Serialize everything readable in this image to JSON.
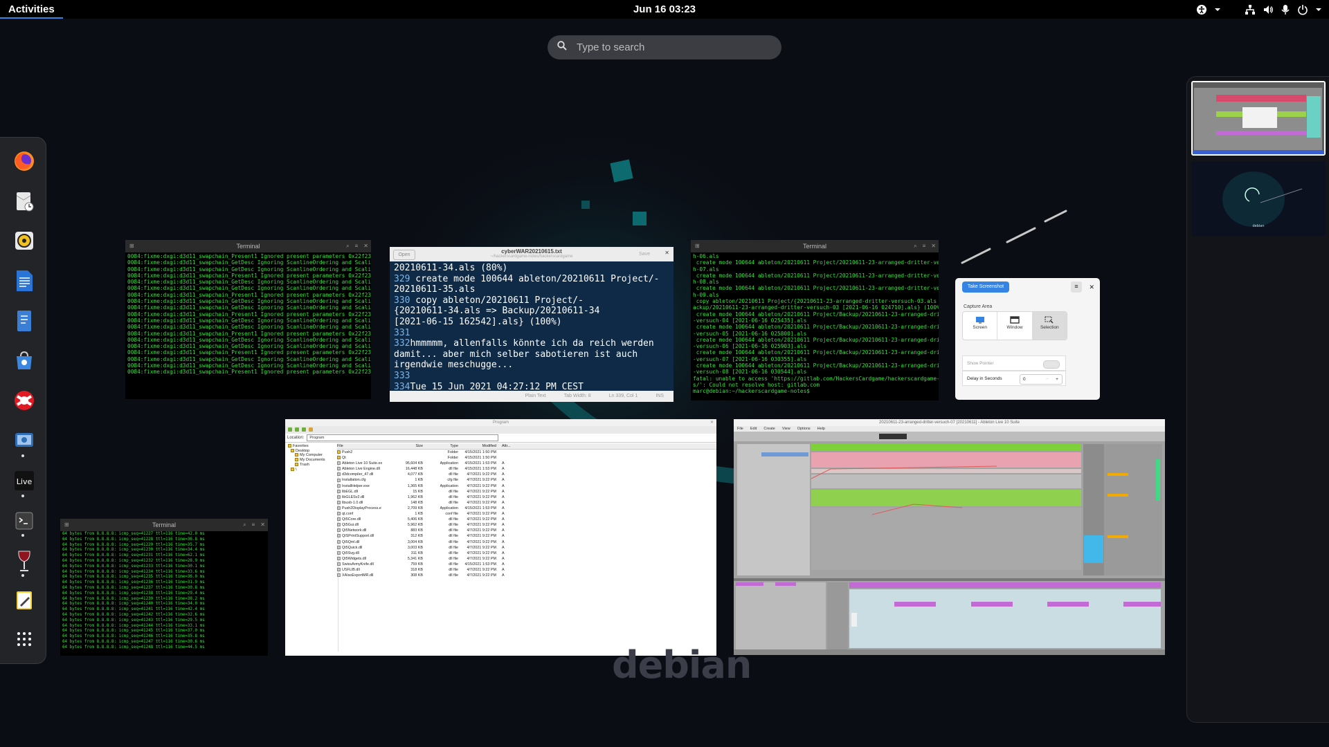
{
  "topbar": {
    "activities_label": "Activities",
    "clock": "Jun 16  03:23",
    "tray_icons": [
      "accessibility-icon",
      "chevron-down-icon",
      "network-icon",
      "volume-icon",
      "microphone-icon",
      "power-icon",
      "chevron-down-icon"
    ]
  },
  "search": {
    "placeholder": "Type to search",
    "value": ""
  },
  "dash": {
    "apps": [
      {
        "name": "firefox-icon",
        "running": false
      },
      {
        "name": "evolution-icon",
        "running": false
      },
      {
        "name": "rhythmbox-icon",
        "running": false
      },
      {
        "name": "writer-icon",
        "running": false
      },
      {
        "name": "document-viewer-icon",
        "running": false
      },
      {
        "name": "software-icon",
        "running": false
      },
      {
        "name": "help-icon",
        "running": false
      },
      {
        "name": "screenshot-icon",
        "running": true
      },
      {
        "name": "ableton-live-icon",
        "running": true
      },
      {
        "name": "terminal-icon",
        "running": true
      },
      {
        "name": "wine-icon",
        "running": true
      },
      {
        "name": "text-editor-icon",
        "running": false
      },
      {
        "name": "show-apps-icon",
        "running": false
      }
    ],
    "live_label": "Live"
  },
  "terminal1": {
    "title": "Terminal",
    "lines": [
      "0084:fixme:dxgi:d3d11_swapchain_Present1 Ignored present parameters 0x22f230.",
      "0084:fixme:dxgi:d3d11_swapchain_GetDesc Ignoring ScanlineOrdering and Scaling.",
      "0084:fixme:dxgi:d3d11_swapchain_GetDesc Ignoring ScanlineOrdering and Scaling.",
      "0084:fixme:dxgi:d3d11_swapchain_Present1 Ignored present parameters 0x22f230.",
      "0084:fixme:dxgi:d3d11_swapchain_GetDesc Ignoring ScanlineOrdering and Scaling.",
      "0084:fixme:dxgi:d3d11_swapchain_GetDesc Ignoring ScanlineOrdering and Scaling.",
      "0084:fixme:dxgi:d3d11_swapchain_Present1 Ignored present parameters 0x22f230.",
      "0084:fixme:dxgi:d3d11_swapchain_GetDesc Ignoring ScanlineOrdering and Scaling.",
      "0084:fixme:dxgi:d3d11_swapchain_GetDesc Ignoring ScanlineOrdering and Scaling.",
      "0084:fixme:dxgi:d3d11_swapchain_Present1 Ignored present parameters 0x22f230.",
      "0084:fixme:dxgi:d3d11_swapchain_GetDesc Ignoring ScanlineOrdering and Scaling.",
      "0084:fixme:dxgi:d3d11_swapchain_GetDesc Ignoring ScanlineOrdering and Scaling.",
      "0084:fixme:dxgi:d3d11_swapchain_Present1 Ignored present parameters 0x22f230.",
      "0084:fixme:dxgi:d3d11_swapchain_GetDesc Ignoring ScanlineOrdering and Scaling.",
      "0084:fixme:dxgi:d3d11_swapchain_GetDesc Ignoring ScanlineOrdering and Scaling.",
      "0084:fixme:dxgi:d3d11_swapchain_Present1 Ignored present parameters 0x22f230.",
      "0084:fixme:dxgi:d3d11_swapchain_GetDesc Ignoring ScanlineOrdering and Scaling.",
      "0084:fixme:dxgi:d3d11_swapchain_GetDesc Ignoring ScanlineOrdering and Scaling.",
      "0084:fixme:dxgi:d3d11_swapchain_Present1 Ignored present parameters 0x22f230."
    ]
  },
  "editor": {
    "title": "cyberWAR20210615.txt",
    "subtitle": "~/hackerscardgame-notes/hackerscardgame",
    "open_label": "Open",
    "save_label": "Save",
    "lines": [
      {
        "n": "",
        "t": "20210611-34.als (80%)"
      },
      {
        "n": "329",
        "t": " create mode 100644 ableton/20210611 Project/-"
      },
      {
        "n": "",
        "t": "20210611-35.als"
      },
      {
        "n": "330",
        "t": " copy ableton/20210611 Project/-"
      },
      {
        "n": "",
        "t": "{20210611-34.als => Backup/20210611-34"
      },
      {
        "n": "",
        "t": "[2021-06-15 162542].als} (100%)"
      },
      {
        "n": "331",
        "t": ""
      },
      {
        "n": "332",
        "t": "hmmmmm, allenfalls könnte ich da reich werden"
      },
      {
        "n": "",
        "t": "damit... aber mich selber sabotieren ist auch"
      },
      {
        "n": "",
        "t": "irgendwie meschugge..."
      },
      {
        "n": "333",
        "t": ""
      },
      {
        "n": "334",
        "t": "Tue 15 Jun 2021 04:27:12 PM CEST"
      }
    ],
    "status": [
      "Plain Text",
      "Tab Width: 8",
      "Ln 339, Col 1",
      "INS"
    ]
  },
  "terminal2": {
    "title": "Terminal",
    "lines": [
      "h-06.als",
      " create mode 100644 ableton/20210611 Project/20210611-23-arranged-dritter-versuc",
      "h-07.als",
      " create mode 100644 ableton/20210611 Project/20210611-23-arranged-dritter-versuc",
      "h-08.als",
      " create mode 100644 ableton/20210611 Project/20210611-23-arranged-dritter-versuc",
      "h-09.als",
      " copy ableton/20210611 Project/{20210611-23-arranged-dritter-versuch-03.als => B",
      "ackup/20210611-23-arranged-dritter-versuch-03 [2021-06-16 024710].als} (100%)",
      " create mode 100644 ableton/20210611 Project/Backup/20210611-23-arranged-dritter",
      "-versuch-04 [2021-06-16 025435].als",
      " create mode 100644 ableton/20210611 Project/Backup/20210611-23-arranged-dritter",
      "-versuch-05 [2021-06-16 025800].als",
      " create mode 100644 ableton/20210611 Project/Backup/20210611-23-arranged-dritter",
      "-versuch-06 [2021-06-16 025903].als",
      " create mode 100644 ableton/20210611 Project/Backup/20210611-23-arranged-dritter",
      "-versuch-07 [2021-06-16 030355].als",
      " create mode 100644 ableton/20210611 Project/Backup/20210611-23-arranged-dritter",
      "-versuch-08 [2021-06-16 030544].als",
      "fatal: unable to access 'https://gitlab.com/HackersCardgame/hackerscardgame-note",
      "s/': Could not resolve host: gitlab.com",
      "marc@debian:~/hackerscardgame-notes$ "
    ]
  },
  "screenshot_dialog": {
    "take_label": "Take Screenshot",
    "capture_area_label": "Capture Area",
    "modes": [
      "Screen",
      "Window",
      "Selection"
    ],
    "show_pointer_label": "Show Pointer",
    "delay_label": "Delay in Seconds",
    "delay_value": "0"
  },
  "terminal3": {
    "title": "Terminal",
    "lines": [
      "64 bytes from 8.8.8.8: icmp_seq=41227 ttl=116 time=42.0 ms",
      "64 bytes from 8.8.8.8: icmp_seq=41228 ttl=116 time=36.8 ms",
      "64 bytes from 8.8.8.8: icmp_seq=41229 ttl=116 time=35.7 ms",
      "64 bytes from 8.8.8.8: icmp_seq=41230 ttl=116 time=34.4 ms",
      "64 bytes from 8.8.8.8: icmp_seq=41231 ttl=116 time=62.1 ms",
      "64 bytes from 8.8.8.8: icmp_seq=41232 ttl=116 time=28.9 ms",
      "64 bytes from 8.8.8.8: icmp_seq=41233 ttl=116 time=30.1 ms",
      "64 bytes from 8.8.8.8: icmp_seq=41234 ttl=116 time=33.6 ms",
      "64 bytes from 8.8.8.8: icmp_seq=41235 ttl=116 time=36.0 ms",
      "64 bytes from 8.8.8.8: icmp_seq=41236 ttl=116 time=31.9 ms",
      "64 bytes from 8.8.8.8: icmp_seq=41237 ttl=116 time=30.8 ms",
      "64 bytes from 8.8.8.8: icmp_seq=41238 ttl=116 time=29.4 ms",
      "64 bytes from 8.8.8.8: icmp_seq=41239 ttl=116 time=38.2 ms",
      "64 bytes from 8.8.8.8: icmp_seq=41240 ttl=116 time=34.0 ms",
      "64 bytes from 8.8.8.8: icmp_seq=41241 ttl=116 time=42.4 ms",
      "64 bytes from 8.8.8.8: icmp_seq=41242 ttl=116 time=32.6 ms",
      "64 bytes from 8.8.8.8: icmp_seq=41243 ttl=116 time=29.5 ms",
      "64 bytes from 8.8.8.8: icmp_seq=41244 ttl=116 time=33.1 ms",
      "64 bytes from 8.8.8.8: icmp_seq=41245 ttl=116 time=37.0 ms",
      "64 bytes from 8.8.8.8: icmp_seq=41246 ttl=116 time=35.8 ms",
      "64 bytes from 8.8.8.8: icmp_seq=41247 ttl=116 time=30.6 ms",
      "64 bytes from 8.8.8.8: icmp_seq=41248 ttl=116 time=44.5 ms"
    ]
  },
  "filemanager": {
    "title": "Program",
    "location_label": "Location:",
    "location_value": "Program",
    "tree": [
      "Favorites",
      "Desktop",
      "My Computer",
      "My Documents",
      "Trash",
      "\\"
    ],
    "columns": [
      "File",
      "Size",
      "Type",
      "Modified",
      "Attr..."
    ],
    "rows": [
      [
        "Push2",
        "",
        "Folder",
        "4/15/2021 1:50 PM",
        "",
        true
      ],
      [
        "Qt",
        "",
        "Folder",
        "4/15/2021 1:50 PM",
        "",
        true
      ],
      [
        "Ableton Live 10 Suite.ex",
        "95,604 KB",
        "Application",
        "4/15/2021 1:53 PM",
        "A",
        false
      ],
      [
        "Ableton Live Engine.dll",
        "16,448 KB",
        "dll file",
        "4/15/2021 1:53 PM",
        "A",
        false
      ],
      [
        "d3dcompiler_47.dll",
        "4,077 KB",
        "dll file",
        "4/7/2021 9:22 PM",
        "A",
        false
      ],
      [
        "Installation.cfg",
        "1 KB",
        "cfg file",
        "4/7/2021 9:22 PM",
        "A",
        false
      ],
      [
        "InstallHelper.exe",
        "1,365 KB",
        "Application",
        "4/7/2021 9:22 PM",
        "A",
        false
      ],
      [
        "libEGL.dll",
        "15 KB",
        "dll file",
        "4/7/2021 9:22 PM",
        "A",
        false
      ],
      [
        "libGLESv2.dll",
        "1,962 KB",
        "dll file",
        "4/7/2021 9:22 PM",
        "A",
        false
      ],
      [
        "libusb-1.0.dll",
        "148 KB",
        "dll file",
        "4/7/2021 9:22 PM",
        "A",
        false
      ],
      [
        "Push2DisplayProcess.e",
        "2,709 KB",
        "Application",
        "4/15/2021 1:53 PM",
        "A",
        false
      ],
      [
        "qt.conf",
        "1 KB",
        "conf file",
        "4/7/2021 9:22 PM",
        "A",
        false
      ],
      [
        "Qt5Core.dll",
        "5,406 KB",
        "dll file",
        "4/7/2021 9:22 PM",
        "A",
        false
      ],
      [
        "Qt5Gui.dll",
        "5,962 KB",
        "dll file",
        "4/7/2021 9:22 PM",
        "A",
        false
      ],
      [
        "Qt5Network.dll",
        "883 KB",
        "dll file",
        "4/7/2021 9:22 PM",
        "A",
        false
      ],
      [
        "QtSPrintSupport.dll",
        "312 KB",
        "dll file",
        "4/7/2021 9:22 PM",
        "A",
        false
      ],
      [
        "Qt5Qml.dll",
        "3,004 KB",
        "dll file",
        "4/7/2021 9:22 PM",
        "A",
        false
      ],
      [
        "Qt5Quick.dll",
        "3,003 KB",
        "dll file",
        "4/7/2021 9:22 PM",
        "A",
        false
      ],
      [
        "Qt5Svg.dll",
        "311 KB",
        "dll file",
        "4/7/2021 9:22 PM",
        "A",
        false
      ],
      [
        "Qt5Widgets.dll",
        "5,341 KB",
        "dll file",
        "4/7/2021 9:22 PM",
        "A",
        false
      ],
      [
        "SwissArmyKnife.dll",
        "759 KB",
        "dll file",
        "4/15/2021 1:53 PM",
        "A",
        false
      ],
      [
        "USFLIB.dll",
        "318 KB",
        "dll file",
        "4/7/2021 9:22 PM",
        "A",
        false
      ],
      [
        "XAIsoExportMR.dll",
        "308 KB",
        "dll file",
        "4/7/2021 9:22 PM",
        "A",
        false
      ]
    ]
  },
  "ableton": {
    "title": "20210611-23-arranged-dritter-versuch-07 [20210611] - Ableton Live 10 Suite",
    "menu": [
      "File",
      "Edit",
      "Create",
      "View",
      "Options",
      "Help"
    ]
  },
  "desktop": {
    "logo_text": "debian"
  },
  "colors": {
    "accent": "#3584e4",
    "terminal_green": "#33e23a",
    "editor_bg": "#0e2a46",
    "debian_teal": "#0e6f78"
  }
}
